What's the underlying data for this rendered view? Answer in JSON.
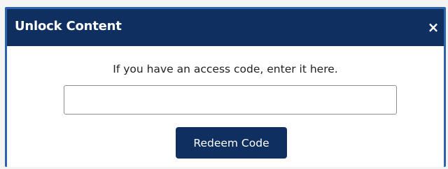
{
  "dialog": {
    "title": "Unlock Content",
    "close_label": "×",
    "instruction": "If you have an access code, enter it here.",
    "code_input": {
      "value": "",
      "placeholder": ""
    },
    "redeem_label": "Redeem Code"
  },
  "colors": {
    "header": "#0e2f5f",
    "button": "#0e2f5f",
    "frame_border": "#2b63ad",
    "background": "#ffffff"
  }
}
